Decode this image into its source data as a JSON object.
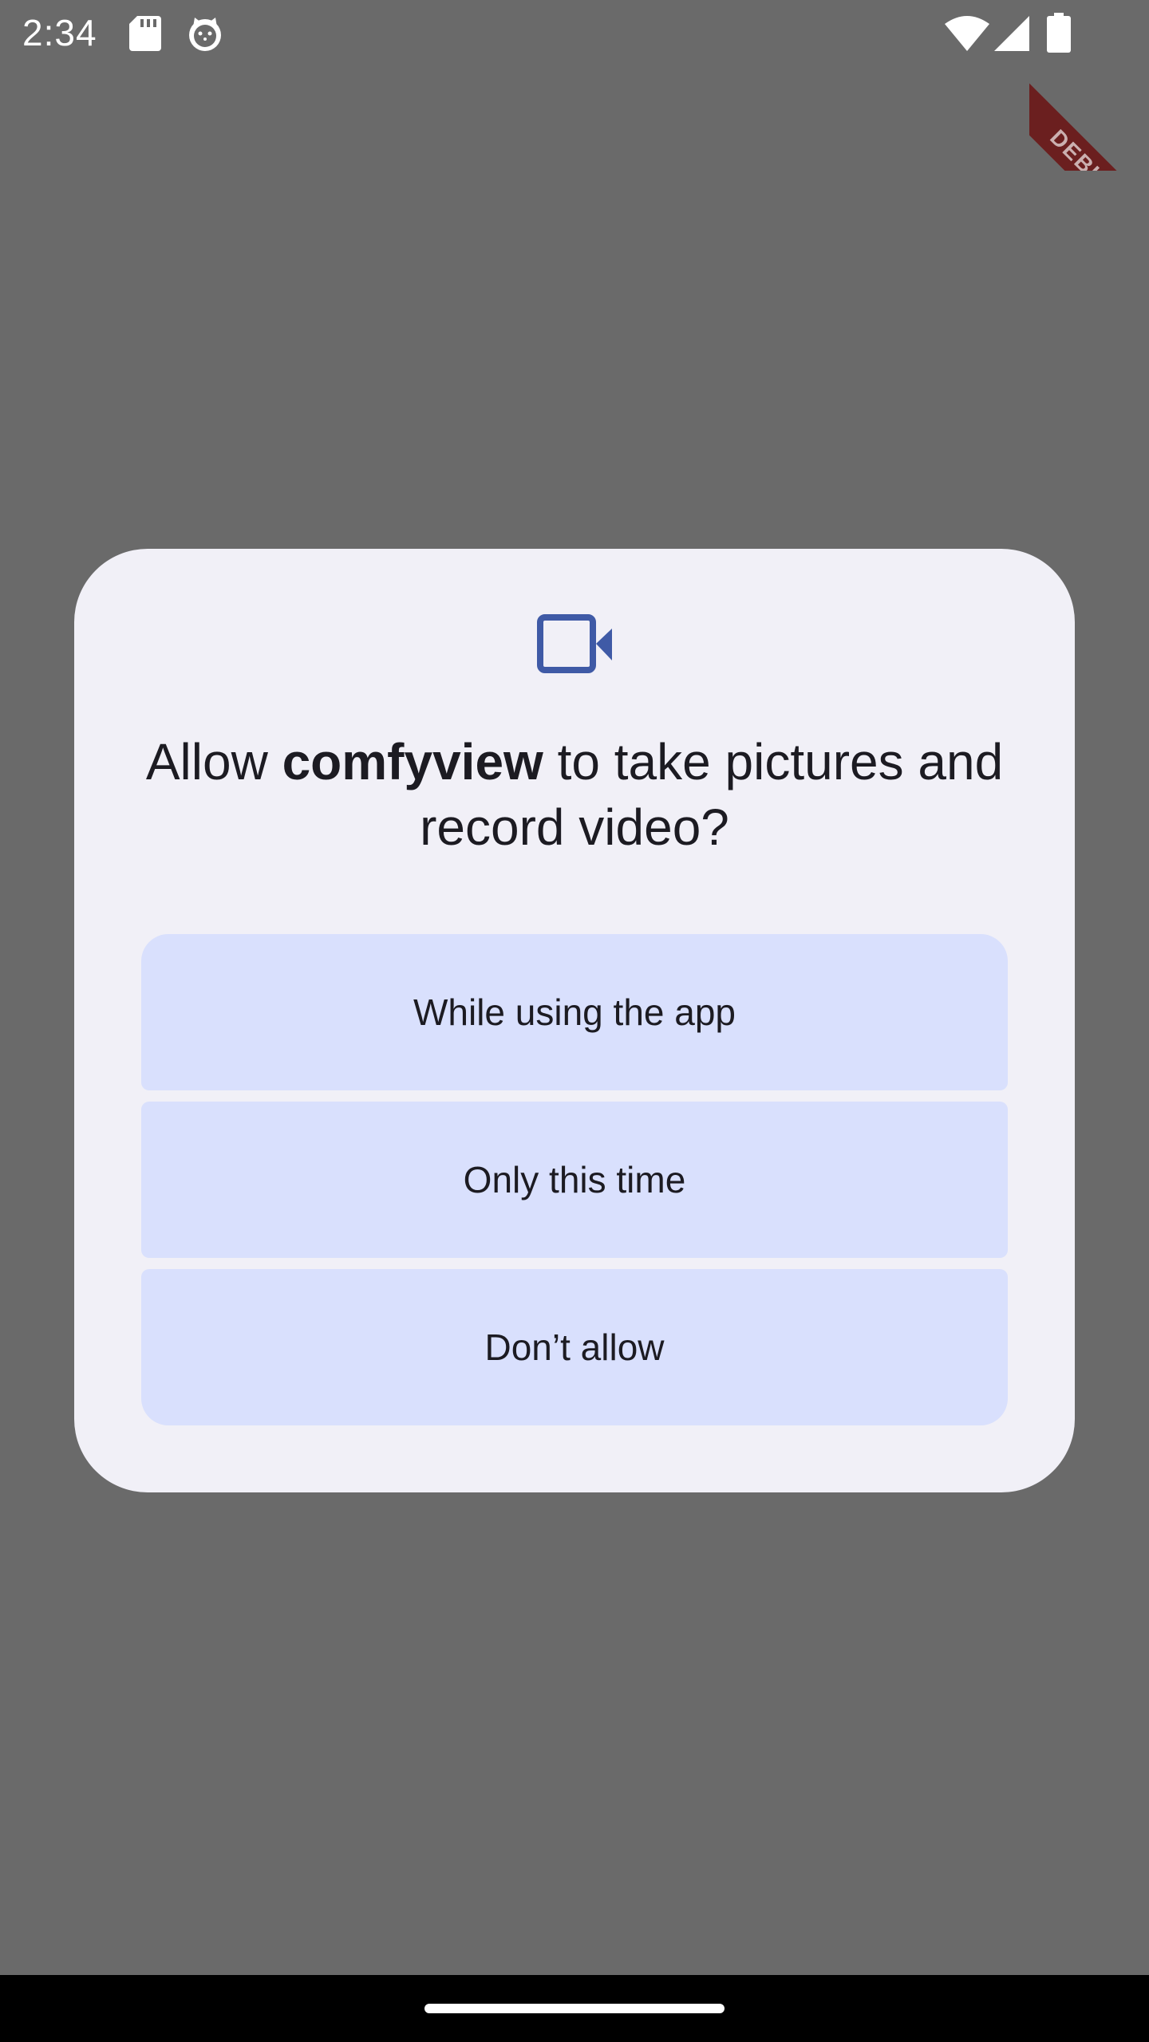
{
  "status_bar": {
    "time": "2:34",
    "icons": [
      "sd-card-icon",
      "cat-face-icon",
      "wifi-icon",
      "cell-signal-icon",
      "battery-icon"
    ]
  },
  "debug_banner": {
    "label": "DEBUG"
  },
  "dialog": {
    "icon": "videocam-icon",
    "title": {
      "prefix": "Allow ",
      "app_name": "comfyview",
      "suffix": " to take pictures and record video?"
    },
    "options": [
      {
        "label": "While using the app"
      },
      {
        "label": "Only this time"
      },
      {
        "label": "Don’t allow"
      }
    ]
  },
  "colors": {
    "scrim": "#6a6a6a",
    "dialog_bg": "#f1f0f7",
    "button_bg": "#d9e0fd",
    "icon_accent": "#3f5aa6",
    "text": "#1c1b22",
    "debug_banner": "#6b1f1f"
  }
}
